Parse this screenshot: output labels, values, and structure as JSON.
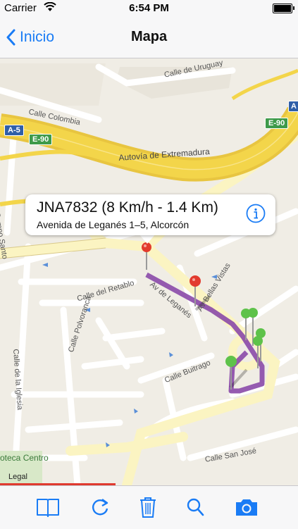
{
  "status_bar": {
    "carrier": "Carrier",
    "time": "6:54 PM"
  },
  "nav": {
    "back_label": "Inicio",
    "title": "Mapa"
  },
  "callout": {
    "title": "JNA7832 (8 Km/h - 1.4 Km)",
    "subtitle": "Avenida de Leganés 1–5, Alcorcón"
  },
  "map": {
    "labels": {
      "a5": "A-5",
      "e90_left": "E-90",
      "e90_right": "E-90",
      "a_sign": "A",
      "calle_uruguay": "Calle de Uruguay",
      "calle_colombia": "Calle Colombia",
      "autovia": "Autovía de Extremadura",
      "campo_santo": "del Campo Santo",
      "calle_retablo": "Calle del Retablo",
      "av_leganes": "Av de Leganés",
      "bellas_vistas": "Av Bellas Vistas",
      "calle_buitrago": "Calle Buitrago",
      "calle_polvoranca": "Calle Polvoranca",
      "calle_iglesia": "Calle de la Iglesia",
      "calle_san_jose": "Calle San José",
      "biblioteca": "oteca Centro"
    },
    "legal": "Legal"
  },
  "toolbar": {
    "icons": [
      "book-icon",
      "refresh-icon",
      "trash-icon",
      "search-icon",
      "camera-icon"
    ]
  },
  "colors": {
    "accent": "#1a7cf5",
    "route": "#8a49a9",
    "highway": "#f3d54a"
  }
}
